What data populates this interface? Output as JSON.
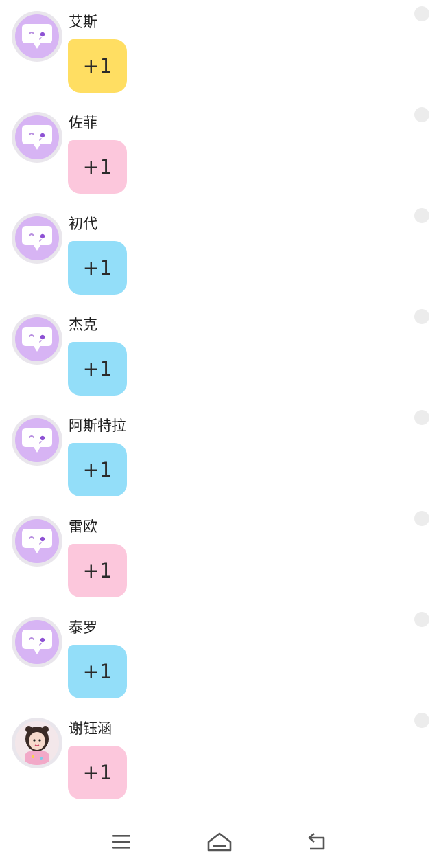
{
  "colors": {
    "yellow": "#ffde62",
    "pink": "#fcc7dc",
    "blue": "#93def9",
    "avatar_purple": "#d7b4f4",
    "unread_dot": "#ececec"
  },
  "messages": [
    {
      "name": "艾斯",
      "text": "+1",
      "bubble_color": "#ffde62",
      "avatar": "chat-bubble-icon"
    },
    {
      "name": "佐菲",
      "text": "+1",
      "bubble_color": "#fcc7dc",
      "avatar": "chat-bubble-icon"
    },
    {
      "name": "初代",
      "text": "+1",
      "bubble_color": "#93def9",
      "avatar": "chat-bubble-icon"
    },
    {
      "name": "杰克",
      "text": "+1",
      "bubble_color": "#93def9",
      "avatar": "chat-bubble-icon"
    },
    {
      "name": "阿斯特拉",
      "text": "+1",
      "bubble_color": "#93def9",
      "avatar": "chat-bubble-icon"
    },
    {
      "name": "雷欧",
      "text": "+1",
      "bubble_color": "#fcc7dc",
      "avatar": "chat-bubble-icon"
    },
    {
      "name": "泰罗",
      "text": "+1",
      "bubble_color": "#93def9",
      "avatar": "chat-bubble-icon"
    },
    {
      "name": "谢钰涵",
      "text": "+1",
      "bubble_color": "#fcc7dc",
      "avatar": "user-photo"
    }
  ],
  "navbar": {
    "menu_icon": "menu-icon",
    "home_icon": "home-icon",
    "back_icon": "back-icon"
  }
}
